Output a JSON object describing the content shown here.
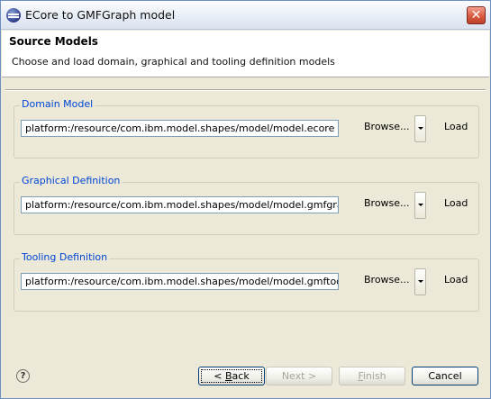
{
  "window": {
    "title": "ECore to GMFGraph model",
    "close_glyph": "✕"
  },
  "header": {
    "title": "Source Models",
    "description": "Choose and load domain, graphical and tooling definition models"
  },
  "groups": [
    {
      "label": "Domain Model",
      "path": "platform:/resource/com.ibm.model.shapes/model/model.ecore",
      "browse": "Browse...",
      "load": "Load"
    },
    {
      "label": "Graphical Definition",
      "path": "platform:/resource/com.ibm.model.shapes/model/model.gmfgraph",
      "browse": "Browse...",
      "load": "Load"
    },
    {
      "label": "Tooling Definition",
      "path": "platform:/resource/com.ibm.model.shapes/model/model.gmftool",
      "browse": "Browse...",
      "load": "Load"
    }
  ],
  "footer": {
    "help_glyph": "?",
    "back_prefix": "< ",
    "back_mnemonic": "B",
    "back_rest": "ack",
    "next": "Next >",
    "finish_mnemonic": "F",
    "finish_rest": "inish",
    "cancel": "Cancel"
  },
  "colors": {
    "group_label": "#0046d5",
    "dialog_bg": "#ece9d8",
    "disabled_text": "#a6a597"
  }
}
